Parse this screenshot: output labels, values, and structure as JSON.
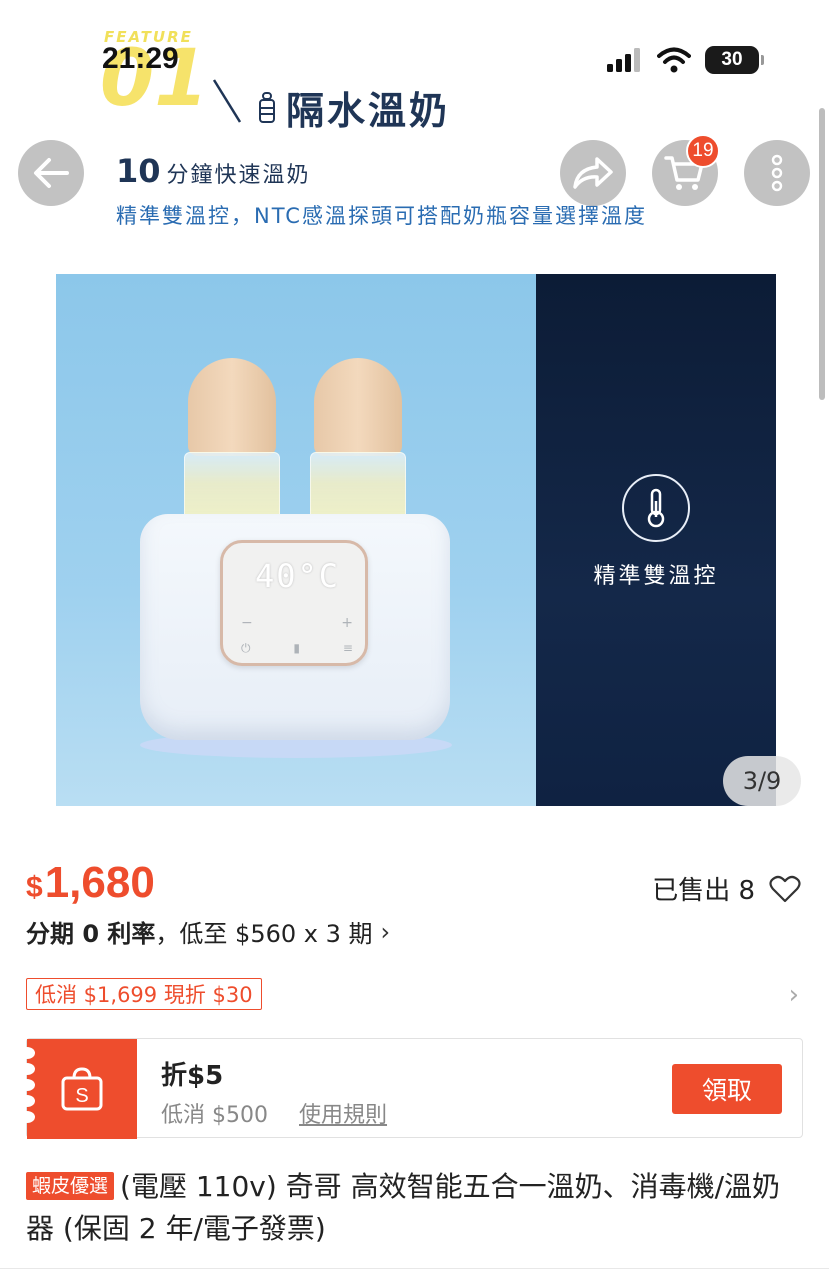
{
  "status_bar": {
    "time": "21:29",
    "battery": "30"
  },
  "hero": {
    "feature_word": "FEATURE",
    "feature_number": "01",
    "feature_title": "隔水溫奶",
    "sub_number": "10",
    "sub_text": "分鐘快速溫奶",
    "sub_line2": "精準雙溫控，NTC感溫探頭可搭配奶瓶容量選擇溫度",
    "panel_label": "精準雙溫控",
    "display_readout": "40°C",
    "panel_minus": "−",
    "panel_plus": "+",
    "page_indicator": "3/9"
  },
  "nav": {
    "cart_count": "19",
    "icons": [
      "back-arrow-icon",
      "share-icon",
      "cart-icon",
      "more-icon"
    ]
  },
  "price": {
    "currency": "$",
    "amount": "1,680",
    "sold_label": "已售出 8",
    "installment_bold": "分期 0 利率",
    "installment_rest": "，低至 $560 x 3 期",
    "installment_chevron": "›"
  },
  "voucher": {
    "tag": "低消 $1,699 現折 $30",
    "chevron": "›"
  },
  "coupon": {
    "title": "折$5",
    "min_spend": "低消 $500",
    "rules_link": "使用規則",
    "claim_button": "領取"
  },
  "product": {
    "badge": "蝦皮優選",
    "title": "(電壓 110v) 奇哥 高效智能五合一溫奶、消毒機/溫奶器 (保固 2 年/電子發票)"
  },
  "colors": {
    "accent": "#ee4d2d",
    "hero_navy": "#1f3556",
    "hero_blue": "#2a6cb2"
  }
}
